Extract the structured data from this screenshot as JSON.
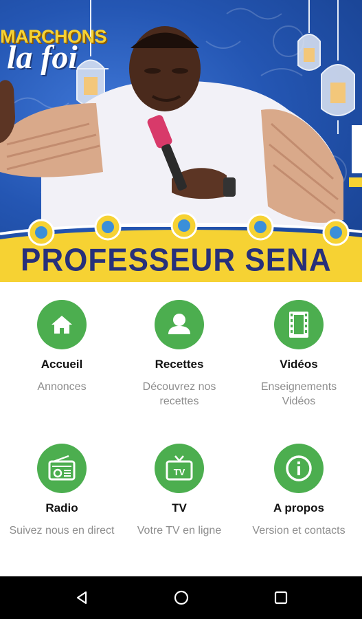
{
  "banner": {
    "title_line1": "MARCHONS",
    "title_line2": "la foi",
    "name": "PROFESSEUR SENA"
  },
  "menu": {
    "items": [
      {
        "title": "Accueil",
        "subtitle": "Annonces",
        "icon": "home-icon"
      },
      {
        "title": "Recettes",
        "subtitle": "Découvrez nos recettes",
        "icon": "person-icon"
      },
      {
        "title": "Vidéos",
        "subtitle": "Enseignements Vidéos",
        "icon": "film-icon"
      },
      {
        "title": "Radio",
        "subtitle": "Suivez nous en direct",
        "icon": "radio-icon"
      },
      {
        "title": "TV",
        "subtitle": "Votre TV en ligne",
        "icon": "tv-icon"
      },
      {
        "title": "A propos",
        "subtitle": "Version et contacts",
        "icon": "info-icon"
      }
    ]
  },
  "navbar": {
    "back_icon": "back-triangle-icon",
    "home_icon": "home-circle-icon",
    "recents_icon": "recents-square-icon"
  },
  "colors": {
    "accent_green": "#4cae4f",
    "title_text": "#111111",
    "subtitle_text": "#8d8d8d",
    "banner_blue": "#2456b3",
    "banner_yellow": "#f6d233",
    "name_navy": "#27307a"
  }
}
